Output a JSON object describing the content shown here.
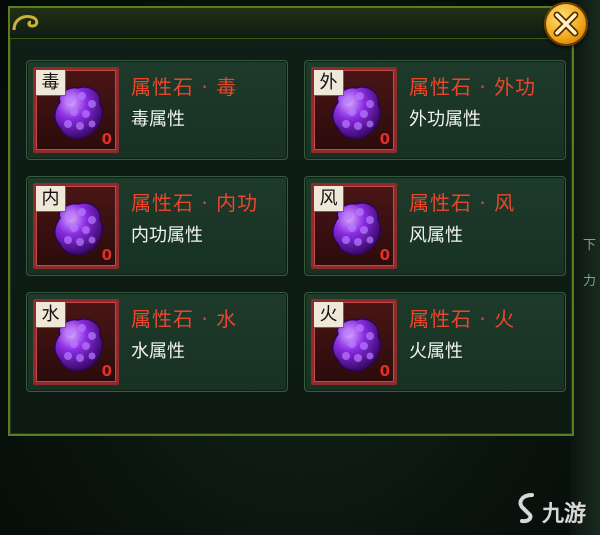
{
  "panel": {
    "close_icon": "close-icon"
  },
  "stones": [
    {
      "tag": "毒",
      "title": "属性石 · 毒",
      "desc": "毒属性",
      "count": "0"
    },
    {
      "tag": "外",
      "title": "属性石 · 外功",
      "desc": "外功属性",
      "count": "0"
    },
    {
      "tag": "内",
      "title": "属性石 · 内功",
      "desc": "内功属性",
      "count": "0"
    },
    {
      "tag": "风",
      "title": "属性石 · 风",
      "desc": "风属性",
      "count": "0"
    },
    {
      "tag": "水",
      "title": "属性石 · 水",
      "desc": "水属性",
      "count": "0"
    },
    {
      "tag": "火",
      "title": "属性石 · 火",
      "desc": "火属性",
      "count": "0"
    }
  ],
  "background": {
    "strip_text_1": "下",
    "strip_text_2": "力"
  },
  "watermark": {
    "text": "九游"
  },
  "colors": {
    "title_red": "#e8472c",
    "gem_purple": "#8a2be2",
    "close_gold": "#f0a516",
    "border_green": "#5a7d1f"
  }
}
